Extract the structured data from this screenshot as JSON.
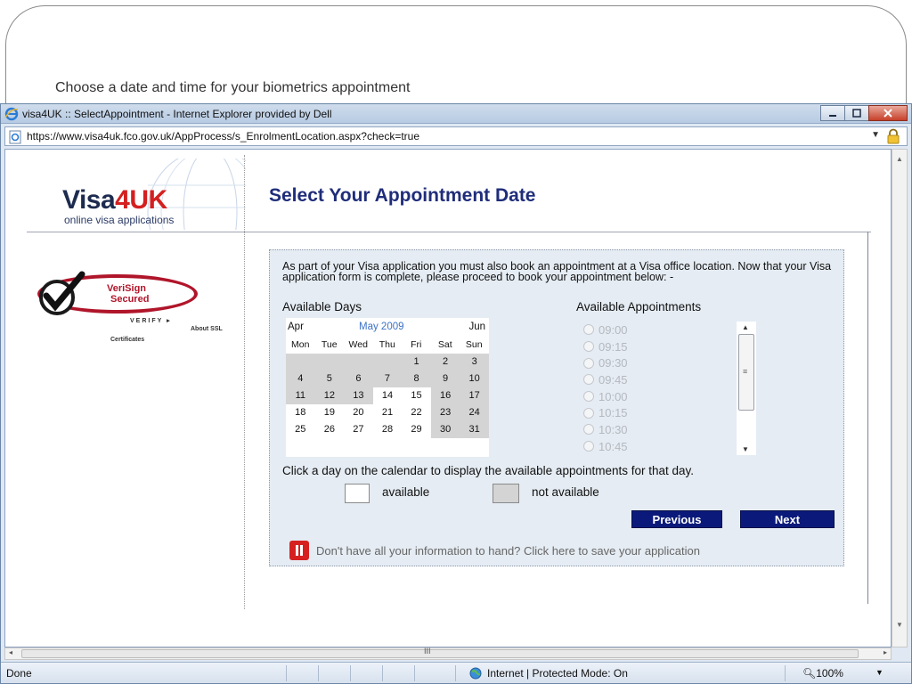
{
  "slide": {
    "caption": "Choose a date and time for your biometrics appointment"
  },
  "window": {
    "title": "visa4UK :: SelectAppointment - Internet Explorer provided by Dell",
    "url": "https://www.visa4uk.fco.gov.uk/AppProcess/s_EnrolmentLocation.aspx?check=true"
  },
  "status": {
    "left": "Done",
    "zone": "Internet | Protected Mode: On",
    "zoom": "100%"
  },
  "page": {
    "logo": {
      "brand_a": "Visa",
      "brand_b": "4UK",
      "tagline": "online visa applications"
    },
    "title": "Select Your Appointment Date",
    "verisign": {
      "name": "VeriSign",
      "secured": "Secured",
      "verify": "VERIFY",
      "about": "About SSL",
      "certificates": "Certificates"
    },
    "intro": "As part of your Visa application you must also book an appointment at a Visa office location.  Now that your Visa application form is complete, please proceed to book your appointment below: -",
    "available_days_label": "Available Days",
    "available_appts_label": "Available Appointments",
    "calendar": {
      "prev": "Apr",
      "month": "May 2009",
      "next": "Jun",
      "weekdays": [
        "Mon",
        "Tue",
        "Wed",
        "Thu",
        "Fri",
        "Sat",
        "Sun"
      ],
      "weeks": [
        [
          {
            "d": "",
            "avail": false
          },
          {
            "d": "",
            "avail": false
          },
          {
            "d": "",
            "avail": false
          },
          {
            "d": "",
            "avail": false
          },
          {
            "d": "1",
            "avail": false
          },
          {
            "d": "2",
            "avail": false
          },
          {
            "d": "3",
            "avail": false
          }
        ],
        [
          {
            "d": "4",
            "avail": false
          },
          {
            "d": "5",
            "avail": false
          },
          {
            "d": "6",
            "avail": false
          },
          {
            "d": "7",
            "avail": false
          },
          {
            "d": "8",
            "avail": false
          },
          {
            "d": "9",
            "avail": false
          },
          {
            "d": "10",
            "avail": false
          }
        ],
        [
          {
            "d": "11",
            "avail": false
          },
          {
            "d": "12",
            "avail": false
          },
          {
            "d": "13",
            "avail": false
          },
          {
            "d": "14",
            "avail": true
          },
          {
            "d": "15",
            "avail": true
          },
          {
            "d": "16",
            "avail": false
          },
          {
            "d": "17",
            "avail": false
          }
        ],
        [
          {
            "d": "18",
            "avail": true
          },
          {
            "d": "19",
            "avail": true
          },
          {
            "d": "20",
            "avail": true
          },
          {
            "d": "21",
            "avail": true
          },
          {
            "d": "22",
            "avail": true
          },
          {
            "d": "23",
            "avail": false
          },
          {
            "d": "24",
            "avail": false
          }
        ],
        [
          {
            "d": "25",
            "avail": true
          },
          {
            "d": "26",
            "avail": true
          },
          {
            "d": "27",
            "avail": true
          },
          {
            "d": "28",
            "avail": true
          },
          {
            "d": "29",
            "avail": true
          },
          {
            "d": "30",
            "avail": false
          },
          {
            "d": "31",
            "avail": false
          }
        ]
      ]
    },
    "slots": [
      "09:00",
      "09:15",
      "09:30",
      "09:45",
      "10:00",
      "10:15",
      "10:30",
      "10:45"
    ],
    "hint": "Click a day on the calendar to display the available appointments for that day.",
    "legend": {
      "available": "available",
      "not_available": "not available"
    },
    "buttons": {
      "previous": "Previous",
      "next": "Next"
    },
    "save_link": "Don't have all your information to hand? Click here to save your application"
  },
  "colors": {
    "title_blue": "#1f2d7a",
    "button_navy": "#0b1a7a",
    "unavailable_grey": "#d4d4d4",
    "panel_bg": "#e5ecf3"
  }
}
